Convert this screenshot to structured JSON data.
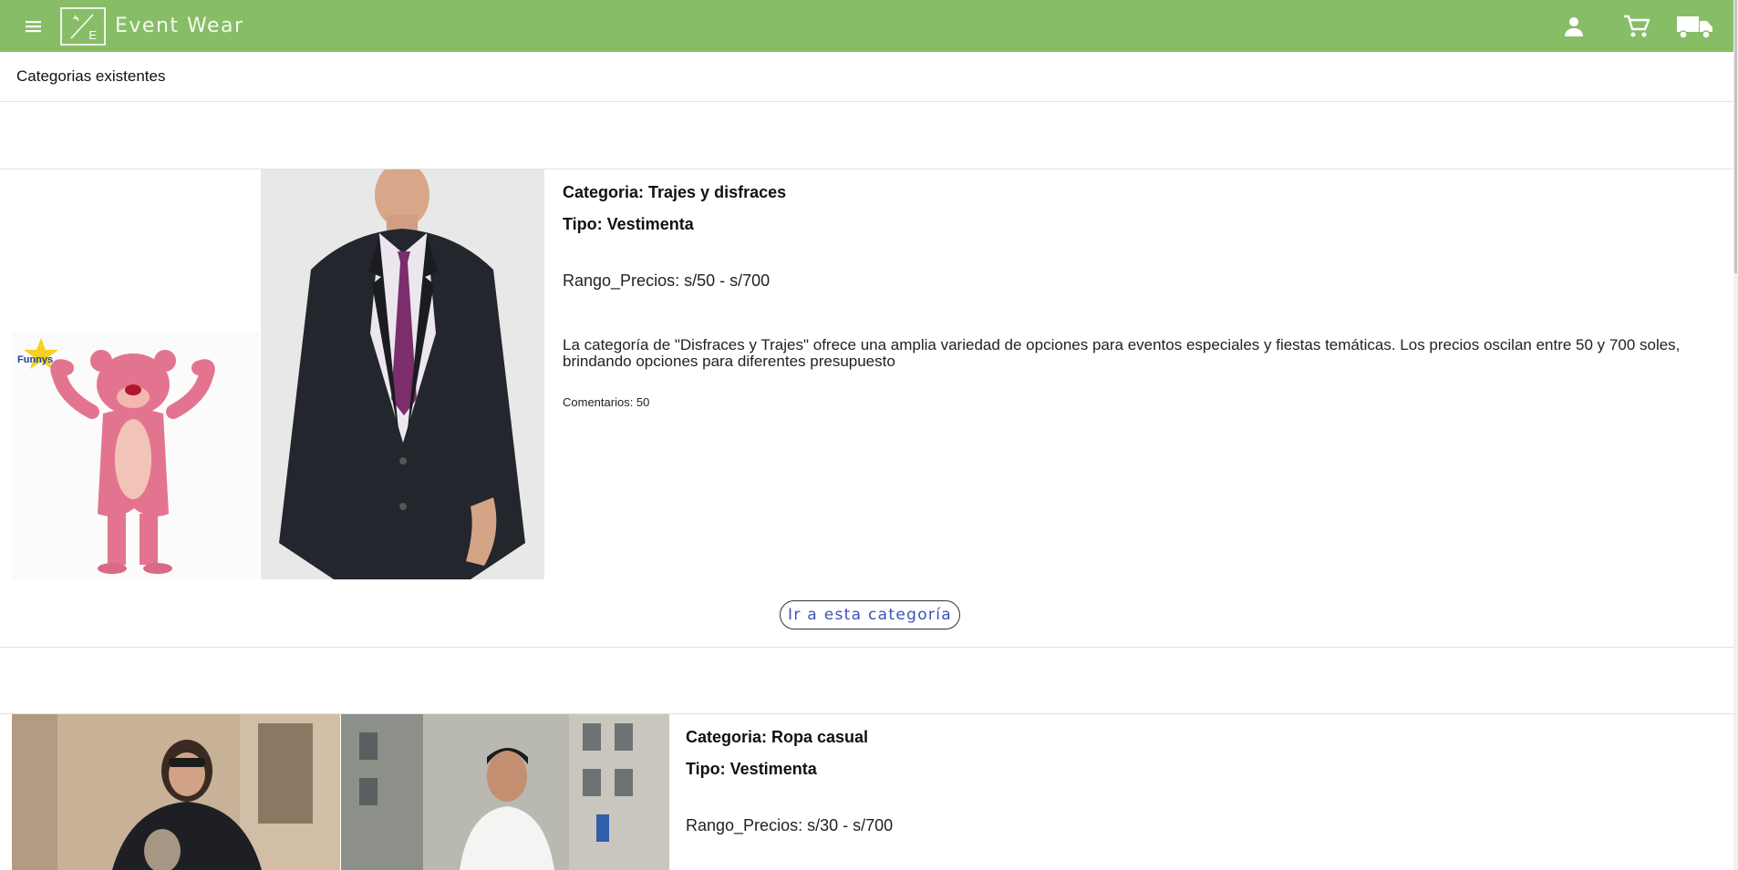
{
  "app": {
    "brand": "Event Wear",
    "logo_letter": "E"
  },
  "page": {
    "section_title": "Categorias existentes"
  },
  "categories": [
    {
      "categoria": "Categoria: Trajes y disfraces",
      "tipo": "Tipo: Vestimenta",
      "rango": "Rango_Precios: s/50 - s/700",
      "descripcion": "La categoría de \"Disfraces y Trajes\" ofrece una amplia variedad de opciones para eventos especiales y fiestas temáticas. Los precios oscilan entre 50 y 700 soles, brindando opciones para diferentes presupuesto",
      "comentarios": "Comentarios: 50",
      "button": "Ir a esta categoría",
      "image_logo_text": "Funnys"
    },
    {
      "categoria": "Categoria: Ropa casual",
      "tipo": "Tipo: Vestimenta",
      "rango": "Rango_Precios: s/30 - s/700"
    }
  ],
  "icons": {
    "menu": "menu-icon",
    "user": "user-icon",
    "cart": "cart-icon",
    "truck": "truck-icon"
  },
  "colors": {
    "toolbar": "#88bd67",
    "button_text": "#3f51b5"
  }
}
